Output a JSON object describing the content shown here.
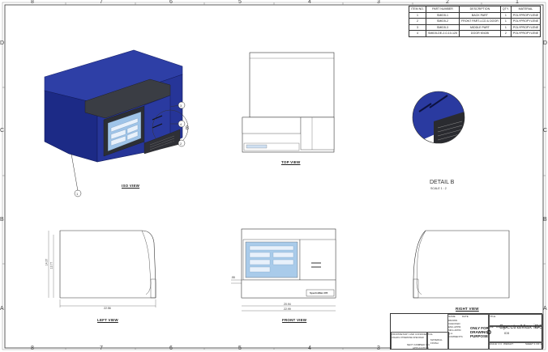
{
  "zones": {
    "columns": [
      "8",
      "7",
      "6",
      "5",
      "4",
      "3",
      "2",
      "1"
    ],
    "rows": [
      "D",
      "C",
      "B",
      "A"
    ]
  },
  "bom": {
    "headers": [
      "ITEM NO.",
      "PART NUMBER",
      "DESCRIPTION",
      "QTY.",
      "MATERIAL"
    ],
    "rows": [
      [
        "1",
        "SMID5-1",
        "BACK PART",
        "1",
        "POLYPROPYLENE"
      ],
      [
        "2",
        "SMID5-2",
        "FRONT PART-LCD & DOOR",
        "1",
        "POLYPROPYLENE"
      ],
      [
        "3",
        "SMID5-3",
        "MIDDLE PART",
        "1",
        "POLYPROPYLENE"
      ],
      [
        "4",
        "SMID5-DE-2-0-10-125",
        "DOOR KNOB",
        "2",
        "POLYPROPYLENE"
      ]
    ]
  },
  "views": {
    "iso": "ISO VIEW",
    "top": "TOP VIEW",
    "left": "LEFT VIEW",
    "front": "FRONT VIEW",
    "right": "RIGHT VIEW",
    "detail_title": "DETAIL B",
    "detail_scale": "SCALE 1 : 2"
  },
  "balloons": [
    "1",
    "2",
    "3",
    "4"
  ],
  "detail_callout": "B",
  "dimensions": {
    "left_width": "22.56",
    "left_height_a": "14.37",
    "left_height_b": "13.77",
    "front_width_a": "20.94",
    "front_width_b": "22.99",
    "front_height": ".55"
  },
  "title_block": {
    "title_label": "TITLE:",
    "title": "SpectraMax iD5",
    "size_label": "SIZE",
    "size": "D",
    "dwg_label": "DWG. NO.",
    "dwg_no": "ID5",
    "rev_label": "REV",
    "scale": "SCALE: 1:4",
    "weight": "WEIGHT:",
    "sheet": "SHEET 1 OF 1",
    "stamp_line1": "ONLY FOR",
    "stamp_line2": "DRAWING",
    "stamp_line3": "PURPOSE",
    "proprietary": "PROPRIETARY AND CONFIDENTIAL",
    "dimensions_note": "UNLESS OTHERWISE SPECIFIED:",
    "drawn": "DRAWN",
    "checked": "CHECKED",
    "eng_appr": "ENG APPR.",
    "mfg_appr": "MFG APPR.",
    "qa": "Q.A.",
    "comments": "COMMENTS:",
    "name": "NAME",
    "date": "DATE",
    "next_assy": "NEXT ASSY",
    "used_on": "USED ON",
    "application": "APPLICATION",
    "finish": "FINISH",
    "material": "MATERIAL"
  },
  "screen_brand": "SpectraMax iD5"
}
